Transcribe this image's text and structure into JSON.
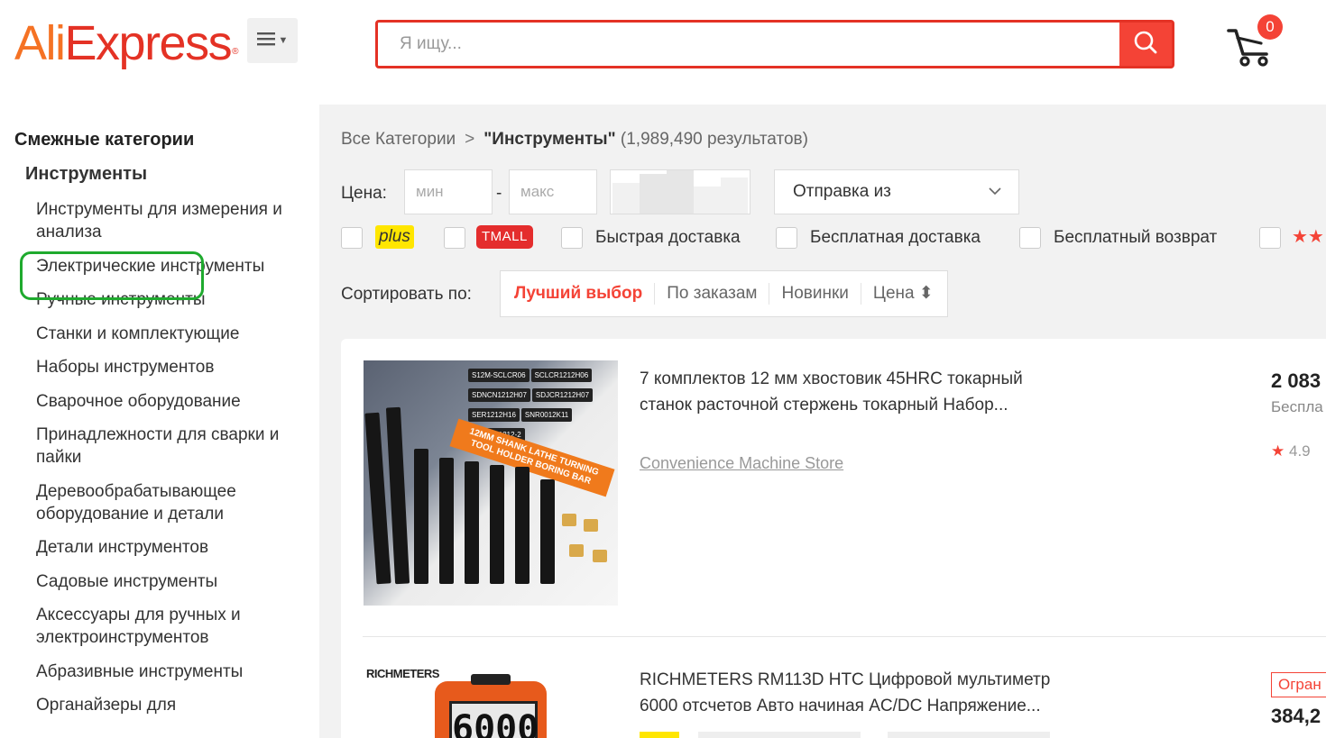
{
  "header": {
    "logo_left": "Ali",
    "logo_right": "Express",
    "logo_mark": "®",
    "menu_icon": "menu-icon",
    "search_placeholder": "Я ищу...",
    "search_icon": "search-icon",
    "cart_icon": "cart-icon",
    "cart_count": "0"
  },
  "sidebar": {
    "title": "Смежные категории",
    "parent": "Инструменты",
    "items": [
      {
        "label": "Инструменты для измерения и анализа"
      },
      {
        "label": "Электрические инструменты"
      },
      {
        "label": "Ручные инструменты"
      },
      {
        "label": "Станки и комплектующие"
      },
      {
        "label": "Наборы инструментов"
      },
      {
        "label": "Сварочное оборудование"
      },
      {
        "label": "Принадлежности для сварки и пайки"
      },
      {
        "label": "Деревообрабатывающее оборудование и детали"
      },
      {
        "label": "Детали инструментов"
      },
      {
        "label": "Садовые инструменты"
      },
      {
        "label": "Аксессуары для ручных и электроинструментов"
      },
      {
        "label": "Абразивные инструменты"
      },
      {
        "label": "Органайзеры для"
      }
    ],
    "highlight_color": "#1faa2e"
  },
  "breadcrumb": {
    "root": "Все Категории",
    "separator": ">",
    "current": "\"Инструменты\"",
    "count": "(1,989,490 результатов)"
  },
  "filters": {
    "price_label": "Цена:",
    "min_placeholder": "мин",
    "dash": "-",
    "max_placeholder": "макс",
    "ship_from": "Отправка из",
    "plus": "plus",
    "tmall": "TMALL",
    "fast_delivery": "Быстрая доставка",
    "free_delivery": "Бесплатная доставка",
    "free_return": "Бесплатный возврат",
    "stars": "★★"
  },
  "sort": {
    "label": "Сортировать по:",
    "options": [
      {
        "label": "Лучший выбор",
        "active": true
      },
      {
        "label": "По заказам",
        "active": false
      },
      {
        "label": "Новинки",
        "active": false
      },
      {
        "label": "Цена ⬍",
        "active": false
      }
    ]
  },
  "products": [
    {
      "title_line1": "7 комплектов 12 мм хвостовик 45HRC токарный",
      "title_line2": "станок расточной стержень токарный Набор...",
      "store": "Convenience Machine Store",
      "price": "2 083",
      "shipping": "Беспла",
      "rating_star": "★",
      "rating": "4.9",
      "image_tags": [
        "S12M-SCLCR06",
        "SCLCR1212H06",
        "SDNCN1212H07",
        "SDJCR1212H07",
        "SER1212H16",
        "SNR0012K11",
        "MGEHR1212-2"
      ],
      "image_banner": "12MM SHANK LATHE TURNING TOOL HOLDER BORING BAR"
    },
    {
      "title_line1": "RICHMETERS RM113D HTC Цифровой мультиметр",
      "title_line2": "6000 отсчетов Авто начиная AC/DC Напряжение...",
      "brand": "RICHMETERS",
      "screen": "6000",
      "badge": "Огран",
      "price": "384,2"
    }
  ],
  "colors": {
    "accent": "#e43225",
    "search_btn": "#f44336",
    "main_bg": "#f2f2f2",
    "plus_bg": "#ffe600"
  }
}
